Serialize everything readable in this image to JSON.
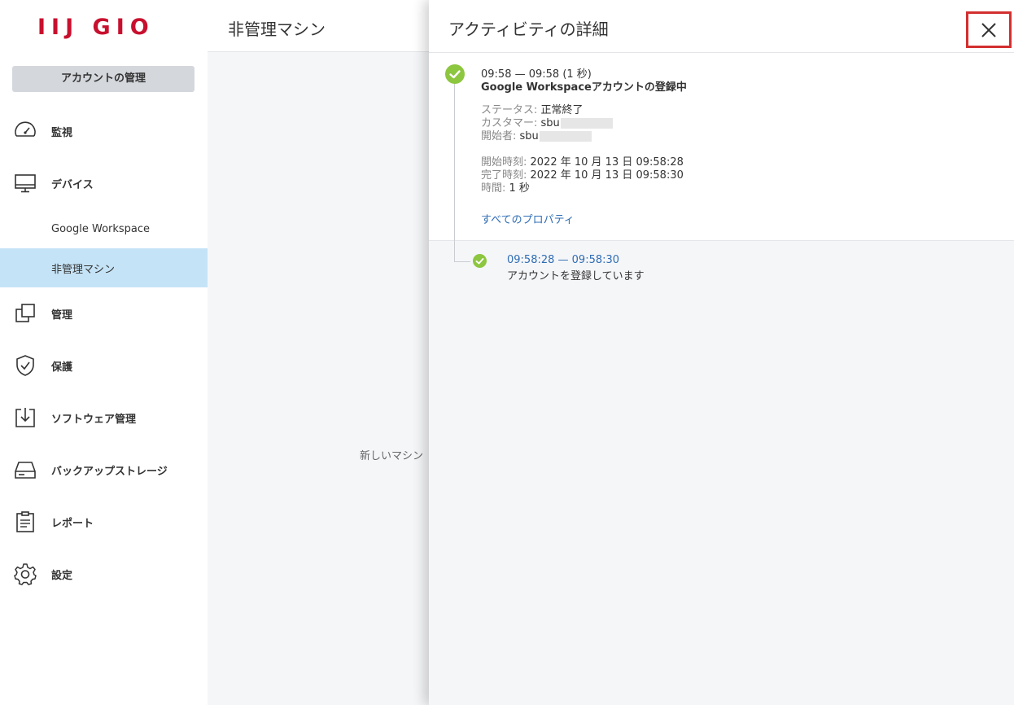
{
  "brand": {
    "logo": "IIJ GIO"
  },
  "sidebar": {
    "account_button": "アカウントの管理",
    "items": [
      {
        "label": "監視",
        "icon": "gauge-icon"
      },
      {
        "label": "デバイス",
        "icon": "monitor-icon"
      },
      {
        "label": "管理",
        "icon": "copy-icon"
      },
      {
        "label": "保護",
        "icon": "shield-icon"
      },
      {
        "label": "ソフトウェア管理",
        "icon": "download-box-icon"
      },
      {
        "label": "バックアップストレージ",
        "icon": "drive-icon"
      },
      {
        "label": "レポート",
        "icon": "clipboard-icon"
      },
      {
        "label": "設定",
        "icon": "gear-icon"
      }
    ],
    "sub_items": [
      {
        "label": "Google Workspace"
      },
      {
        "label": "非管理マシン",
        "active": true
      }
    ]
  },
  "main": {
    "title": "非管理マシン",
    "empty_text": "新しいマシン"
  },
  "panel": {
    "title": "アクティビティの詳細",
    "activity": {
      "time": "09:58 — 09:58 (1 秒)",
      "name": "Google Workspaceアカウントの登録中",
      "properties": [
        {
          "key": "ステータス:",
          "value": "正常終了"
        },
        {
          "key": "カスタマー:",
          "value": "sbu"
        },
        {
          "key": "開始者:",
          "value": "sbu"
        }
      ],
      "timing": [
        {
          "key": "開始時刻:",
          "value": "2022 年 10 月 13 日 09:58:28"
        },
        {
          "key": "完了時刻:",
          "value": "2022 年 10 月 13 日 09:58:30"
        },
        {
          "key": "時間:",
          "value": "1 秒"
        }
      ],
      "all_properties_link": "すべてのプロパティ"
    },
    "sub_activity": {
      "time": "09:58:28 — 09:58:30",
      "description": "アカウントを登録しています"
    }
  },
  "colors": {
    "brand": "#c8102e",
    "accent": "#2f6db5",
    "success": "#8dc63f",
    "active_nav": "#c5e3f6",
    "highlight": "#d32f2f"
  }
}
